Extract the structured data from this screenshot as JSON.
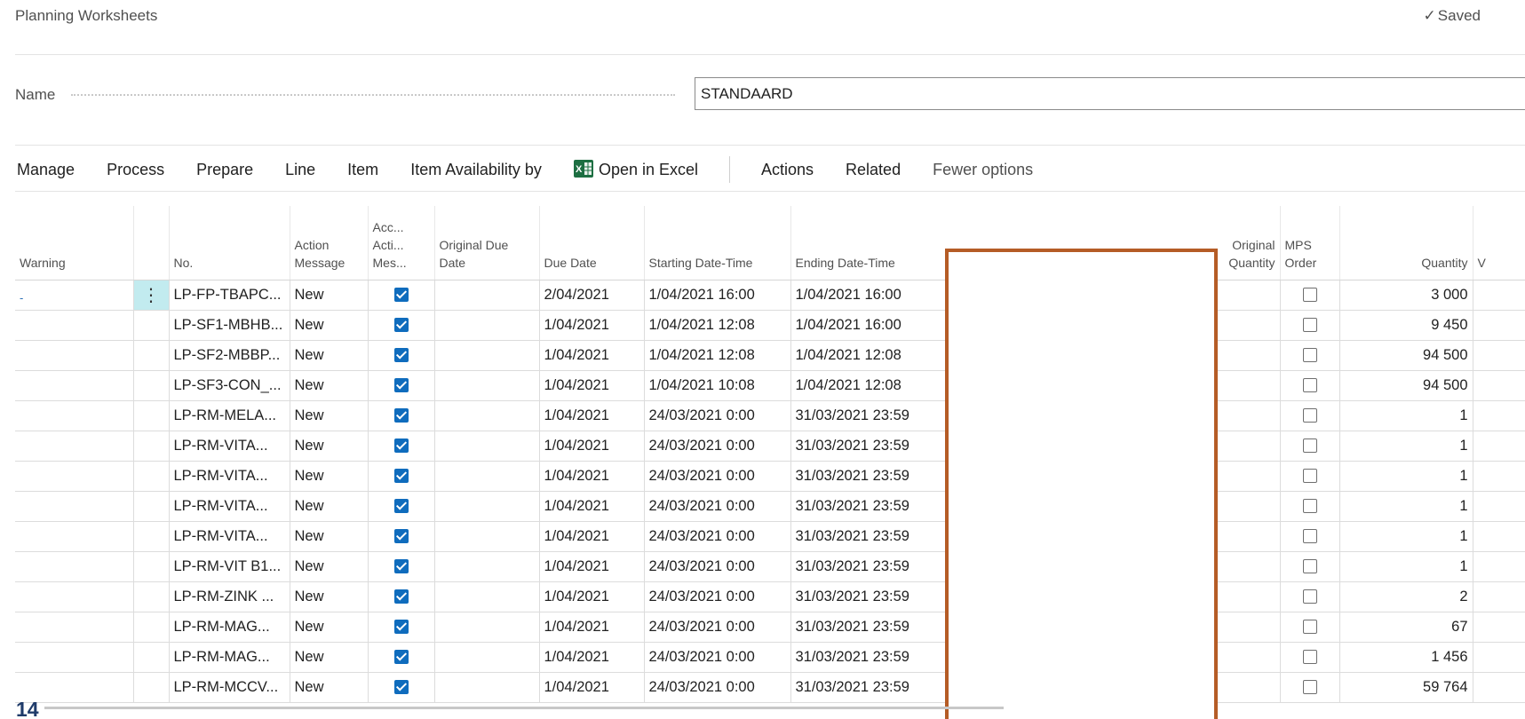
{
  "page": {
    "title": "Planning Worksheets",
    "saved_label": "Saved"
  },
  "name_field": {
    "label": "Name",
    "value": "STANDAARD"
  },
  "actionbar": {
    "items": [
      "Manage",
      "Process",
      "Prepare",
      "Line",
      "Item",
      "Item Availability by"
    ],
    "open_in_excel": "Open in Excel",
    "actions": "Actions",
    "related": "Related",
    "fewer_options": "Fewer options"
  },
  "columns": {
    "warning": "Warning",
    "no": "No.",
    "action_message_1": "Action",
    "action_message_2": "Message",
    "accept_1": "Acc...",
    "accept_2": "Acti...",
    "accept_3": "Mes...",
    "orig_due_1": "Original Due",
    "orig_due_2": "Date",
    "due_date": "Due Date",
    "starting": "Starting Date-Time",
    "ending": "Ending Date-Time",
    "orig_qty_1": "Original",
    "orig_qty_2": "Quantity",
    "mps_1": "MPS",
    "mps_2": "Order",
    "quantity": "Quantity",
    "next": "V"
  },
  "rows": [
    {
      "warning": "-",
      "no": "LP-FP-TBAPC...",
      "action": "New",
      "accept": true,
      "orig_due": "",
      "due": "2/04/2021",
      "start": "1/04/2021 16:00",
      "end": "1/04/2021 16:00",
      "mps": false,
      "qty": "3 000"
    },
    {
      "warning": "",
      "no": "LP-SF1-MBHB...",
      "action": "New",
      "accept": true,
      "orig_due": "",
      "due": "1/04/2021",
      "start": "1/04/2021 12:08",
      "end": "1/04/2021 16:00",
      "mps": false,
      "qty": "9 450"
    },
    {
      "warning": "",
      "no": "LP-SF2-MBBP...",
      "action": "New",
      "accept": true,
      "orig_due": "",
      "due": "1/04/2021",
      "start": "1/04/2021 12:08",
      "end": "1/04/2021 12:08",
      "mps": false,
      "qty": "94 500"
    },
    {
      "warning": "",
      "no": "LP-SF3-CON_...",
      "action": "New",
      "accept": true,
      "orig_due": "",
      "due": "1/04/2021",
      "start": "1/04/2021 10:08",
      "end": "1/04/2021 12:08",
      "mps": false,
      "qty": "94 500"
    },
    {
      "warning": "",
      "no": "LP-RM-MELA...",
      "action": "New",
      "accept": true,
      "orig_due": "",
      "due": "1/04/2021",
      "start": "24/03/2021 0:00",
      "end": "31/03/2021 23:59",
      "mps": false,
      "qty": "1"
    },
    {
      "warning": "",
      "no": "LP-RM-VITA...",
      "action": "New",
      "accept": true,
      "orig_due": "",
      "due": "1/04/2021",
      "start": "24/03/2021 0:00",
      "end": "31/03/2021 23:59",
      "mps": false,
      "qty": "1"
    },
    {
      "warning": "",
      "no": "LP-RM-VITA...",
      "action": "New",
      "accept": true,
      "orig_due": "",
      "due": "1/04/2021",
      "start": "24/03/2021 0:00",
      "end": "31/03/2021 23:59",
      "mps": false,
      "qty": "1"
    },
    {
      "warning": "",
      "no": "LP-RM-VITA...",
      "action": "New",
      "accept": true,
      "orig_due": "",
      "due": "1/04/2021",
      "start": "24/03/2021 0:00",
      "end": "31/03/2021 23:59",
      "mps": false,
      "qty": "1"
    },
    {
      "warning": "",
      "no": "LP-RM-VITA...",
      "action": "New",
      "accept": true,
      "orig_due": "",
      "due": "1/04/2021",
      "start": "24/03/2021 0:00",
      "end": "31/03/2021 23:59",
      "mps": false,
      "qty": "1"
    },
    {
      "warning": "",
      "no": "LP-RM-VIT B1...",
      "action": "New",
      "accept": true,
      "orig_due": "",
      "due": "1/04/2021",
      "start": "24/03/2021 0:00",
      "end": "31/03/2021 23:59",
      "mps": false,
      "qty": "1"
    },
    {
      "warning": "",
      "no": "LP-RM-ZINK ...",
      "action": "New",
      "accept": true,
      "orig_due": "",
      "due": "1/04/2021",
      "start": "24/03/2021 0:00",
      "end": "31/03/2021 23:59",
      "mps": false,
      "qty": "2"
    },
    {
      "warning": "",
      "no": "LP-RM-MAG...",
      "action": "New",
      "accept": true,
      "orig_due": "",
      "due": "1/04/2021",
      "start": "24/03/2021 0:00",
      "end": "31/03/2021 23:59",
      "mps": false,
      "qty": "67"
    },
    {
      "warning": "",
      "no": "LP-RM-MAG...",
      "action": "New",
      "accept": true,
      "orig_due": "",
      "due": "1/04/2021",
      "start": "24/03/2021 0:00",
      "end": "31/03/2021 23:59",
      "mps": false,
      "qty": "1 456"
    },
    {
      "warning": "",
      "no": "LP-RM-MCCV...",
      "action": "New",
      "accept": true,
      "orig_due": "",
      "due": "1/04/2021",
      "start": "24/03/2021 0:00",
      "end": "31/03/2021 23:59",
      "mps": false,
      "qty": "59 764"
    }
  ],
  "footer": {
    "number": "14"
  },
  "colors": {
    "accent": "#0f6cbd",
    "menu_cell": "#c2ebef",
    "redaction_border": "#b55c26",
    "excel_green": "#1d6f42"
  },
  "icons": {
    "saved": "checkmark-icon",
    "excel": "excel-icon",
    "row_menu": "vertical-ellipsis-icon"
  }
}
